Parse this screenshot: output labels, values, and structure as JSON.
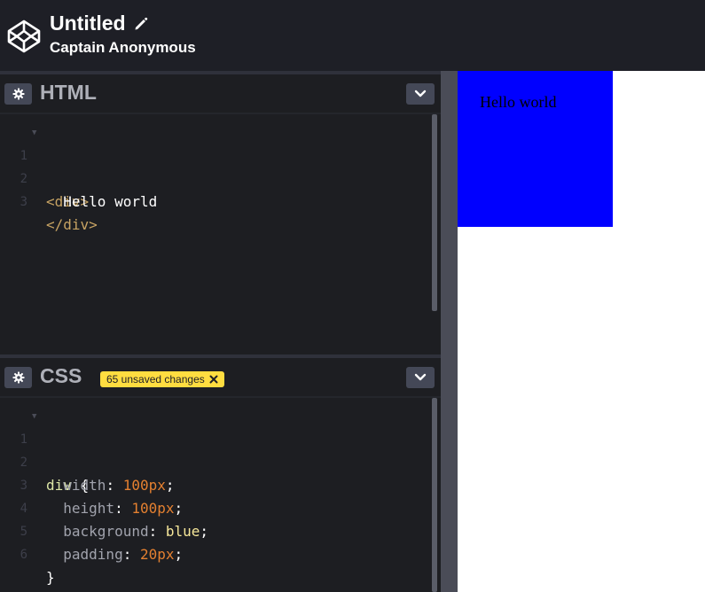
{
  "header": {
    "title": "Untitled",
    "author": "Captain Anonymous",
    "icons": [
      "codepen-logo-icon",
      "pencil-icon"
    ]
  },
  "html_pane": {
    "title": "HTML",
    "line_numbers": [
      "1",
      "2",
      "3"
    ],
    "lines": {
      "l1_tag": "<div>",
      "l2_text": "  Hello world",
      "l3_tag": "</div>"
    },
    "icons": [
      "gear-icon",
      "chevron-down-icon"
    ]
  },
  "css_pane": {
    "title": "CSS",
    "badge": "65 unsaved changes",
    "line_numbers": [
      "1",
      "2",
      "3",
      "4",
      "5",
      "6"
    ],
    "lines": {
      "l1_selector": "div",
      "l1_brace": " {",
      "l2_prop": "  width",
      "l2_value": "100px",
      "l3_prop": "  height",
      "l3_value": "100px",
      "l4_prop": "  background",
      "l4_value": "blue",
      "l5_prop": "  padding",
      "l5_value": "20px",
      "l6_brace": "}",
      "colon": ": ",
      "semicolon": ";"
    },
    "icons": [
      "gear-icon",
      "chevron-down-icon",
      "close-icon"
    ]
  },
  "preview": {
    "content": "Hello world",
    "box_color": "#0000ff"
  },
  "colors": {
    "header_bg": "#1e1f26",
    "editor_bg": "#1d1e22",
    "badge_bg": "#ffdd40"
  }
}
